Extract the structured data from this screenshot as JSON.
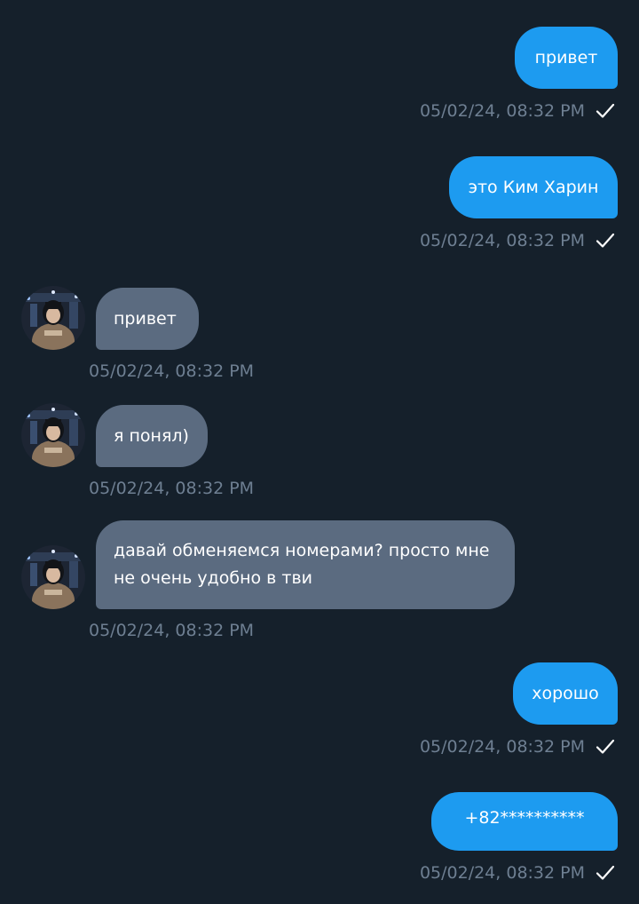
{
  "colors": {
    "background": "#15202b",
    "outgoing_bubble": "#1d9bf0",
    "incoming_bubble": "#5b6b80",
    "timestamp": "#6e7f92",
    "message_text": "#ffffff"
  },
  "messages": [
    {
      "direction": "outgoing",
      "text": "привет",
      "time": "05/02/24, 08:32 PM",
      "status_icon": "check-icon"
    },
    {
      "direction": "outgoing",
      "text": "это Ким Харин",
      "time": "05/02/24, 08:32 PM",
      "status_icon": "check-icon"
    },
    {
      "direction": "incoming",
      "text": "привет",
      "time": "05/02/24, 08:32 PM",
      "avatar_icon": "avatar-image"
    },
    {
      "direction": "incoming",
      "text": "я понял)",
      "time": "05/02/24, 08:32 PM",
      "avatar_icon": "avatar-image"
    },
    {
      "direction": "incoming",
      "text": "давай обменяемся номерами? просто мне не очень удобно в тви",
      "time": "05/02/24, 08:32 PM",
      "avatar_icon": "avatar-image"
    },
    {
      "direction": "outgoing",
      "text": "хорошо",
      "time": "05/02/24, 08:32 PM",
      "status_icon": "check-icon"
    },
    {
      "direction": "outgoing",
      "text": "+82**********",
      "time": "05/02/24, 08:32 PM",
      "status_icon": "check-icon"
    }
  ]
}
